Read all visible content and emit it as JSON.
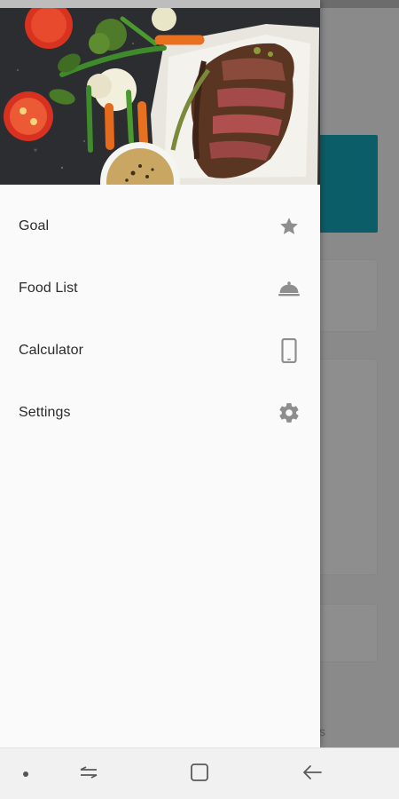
{
  "drawer": {
    "header_image_alt": "grilled steak with vegetables",
    "items": [
      {
        "label": "Goal",
        "icon": "star-icon"
      },
      {
        "label": "Food List",
        "icon": "cloche-icon"
      },
      {
        "label": "Calculator",
        "icon": "smartphone-icon"
      },
      {
        "label": "Settings",
        "icon": "gear-icon"
      }
    ]
  },
  "background": {
    "partial_text": "s"
  },
  "navbar": {
    "buttons": [
      "dot-icon",
      "recent-apps-icon",
      "home-icon",
      "back-icon"
    ]
  },
  "colors": {
    "accent_teal": "#0b5e68",
    "icon_gray": "#8e8e8e",
    "drawer_bg": "#fafafa"
  }
}
